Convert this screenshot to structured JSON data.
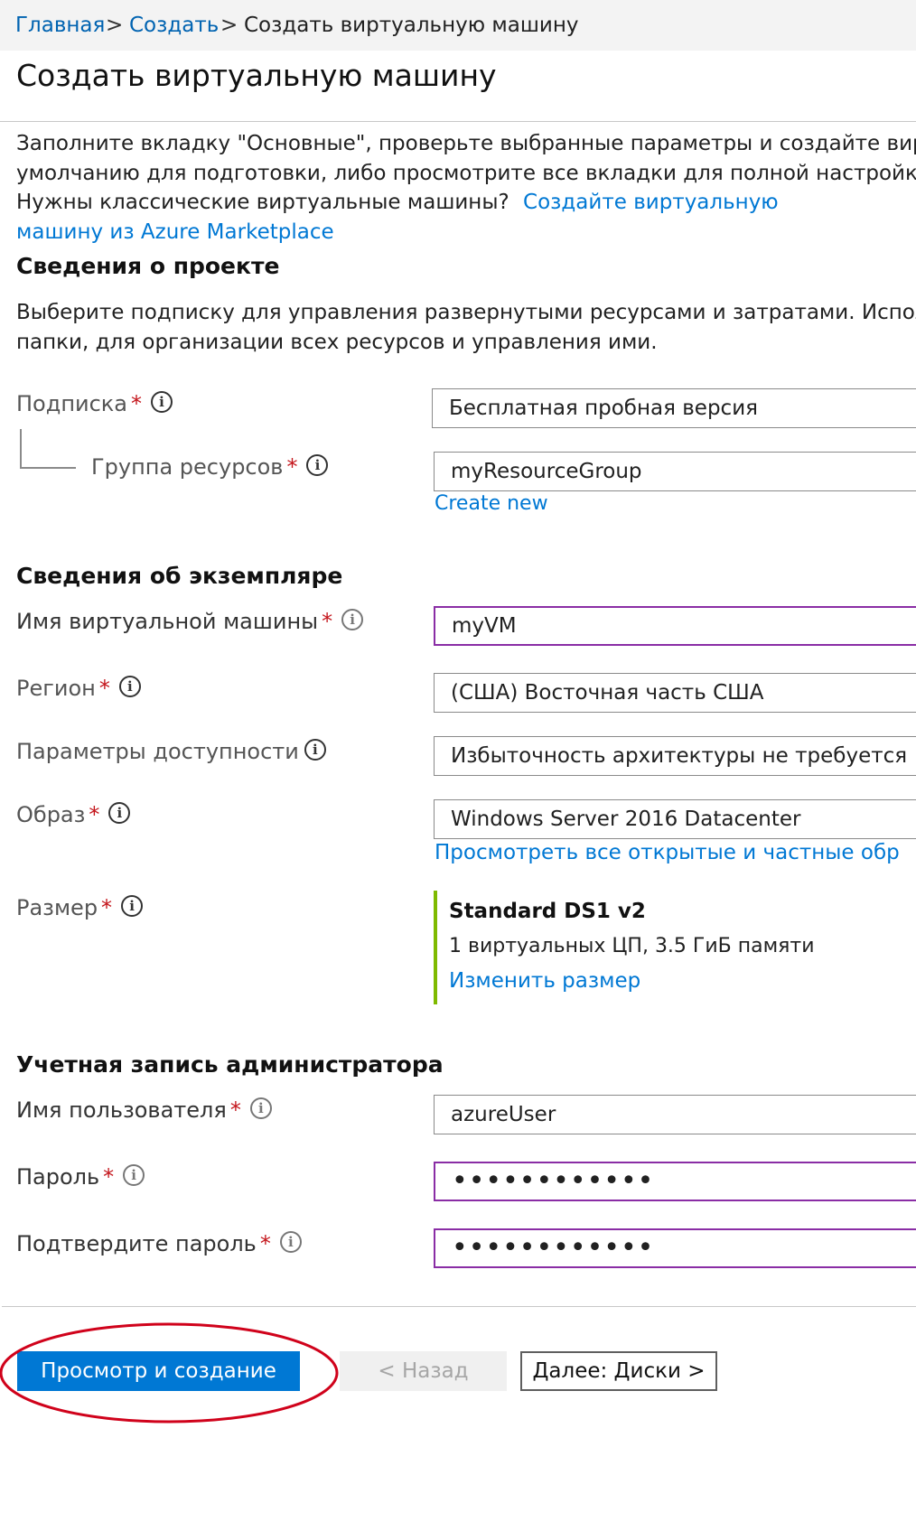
{
  "breadcrumb": {
    "home": "Главная",
    "create": "Создать",
    "current": "Создать виртуальную машину",
    "separator": ">"
  },
  "page_title": "Создать виртуальную машину",
  "intro": {
    "line1": "Заполните вкладку \"Основные\", проверьте выбранные параметры и создайте вирту",
    "line2": "умолчанию для подготовки, либо просмотрите все вкладки для полной настройки.",
    "line3_text": "Нужны классические виртуальные машины?",
    "line3_link": "Создайте виртуальную",
    "line4_link": "машину из Azure Marketplace"
  },
  "project": {
    "heading": "Сведения о проекте",
    "desc1": "Выберите подписку для управления развернутыми ресурсами и затратами. Исполь",
    "desc2": "папки, для организации всех ресурсов и управления ими.",
    "subscription_label": "Подписка",
    "subscription_value": "Бесплатная пробная версия",
    "resource_group_label": "Группа ресурсов",
    "resource_group_value": "myResourceGroup",
    "create_new": "Create new"
  },
  "instance": {
    "heading": "Сведения об экземпляре",
    "vm_name_label": "Имя виртуальной машины",
    "vm_name_value": "myVM",
    "region_label": "Регион",
    "region_value": "(США) Восточная часть США",
    "availability_label": "Параметры доступности",
    "availability_value": "Избыточность архитектуры не требуется",
    "image_label": "Образ",
    "image_value": "Windows Server 2016 Datacenter",
    "image_link": "Просмотреть все открытые и частные обр",
    "size_label": "Размер",
    "size_name": "Standard DS1 v2",
    "size_desc": "1 виртуальных ЦП, 3.5 ГиБ памяти",
    "size_link": "Изменить размер"
  },
  "admin": {
    "heading": "Учетная запись администратора",
    "username_label": "Имя пользователя",
    "username_value": "azureUser",
    "password_label": "Пароль",
    "password_value": "••••••••••••",
    "confirm_label": "Подтвердите пароль",
    "confirm_value": "••••••••••••"
  },
  "footer": {
    "review_create": "Просмотр и создание",
    "back": "< Назад",
    "next": "Далее: Диски >"
  },
  "required_mark": "*",
  "info_glyph": "i",
  "colors": {
    "accent": "#0078d4",
    "link": "#0063b1",
    "required": "#c4161c",
    "focus_border": "#8a2da5",
    "size_bar": "#7fba00",
    "annotation": "#d0021b"
  }
}
